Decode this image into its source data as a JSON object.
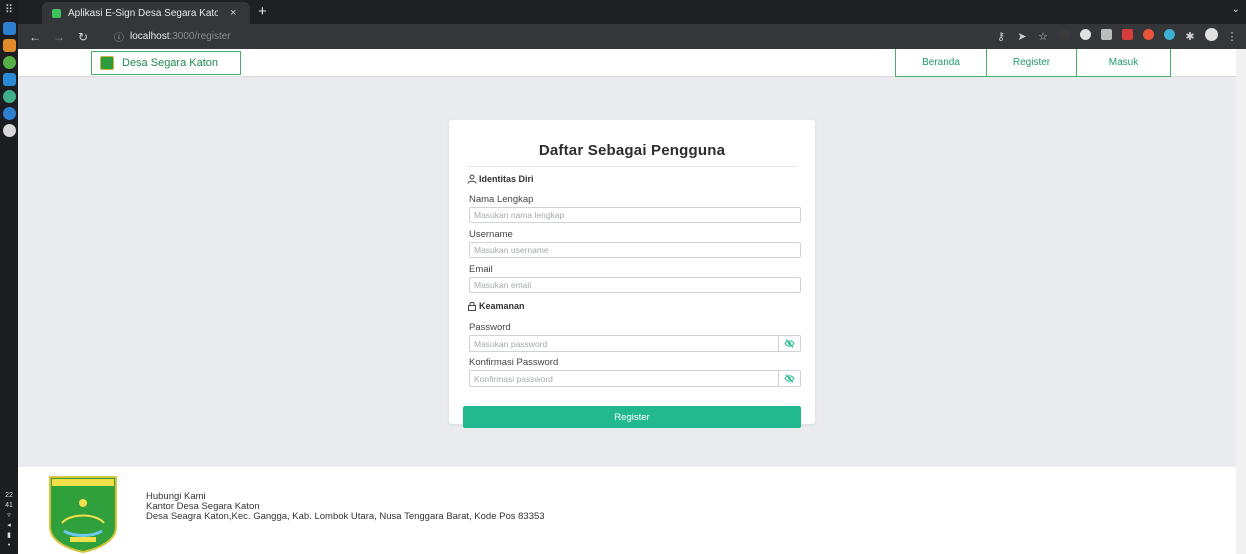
{
  "dock": {
    "grid_glyph": "⠿",
    "apps": [
      {
        "icon": "files-icon",
        "color": "#2f7fd1"
      },
      {
        "icon": "store-icon",
        "color": "#e08a2a"
      },
      {
        "icon": "chrome-icon",
        "color": "#56b046"
      },
      {
        "icon": "vscode-icon",
        "color": "#2a8ad6"
      },
      {
        "icon": "emoji-icon",
        "color": "#3fb08a"
      },
      {
        "icon": "check-icon",
        "color": "#2f7fd1"
      },
      {
        "icon": "drive-icon",
        "color": "#d8d8d8"
      }
    ],
    "clock_hour": "22",
    "clock_minute": "41"
  },
  "browser": {
    "tab_title": "Aplikasi E-Sign Desa Segara Katon",
    "tab_close": "×",
    "new_tab": "+",
    "address_host": "localhost",
    "address_path": ":3000/register"
  },
  "navbar": {
    "brand": "Desa Segara Katon",
    "links": {
      "beranda": "Beranda",
      "register": "Register",
      "masuk": "Masuk"
    }
  },
  "form": {
    "title": "Daftar Sebagai Pengguna",
    "section_identity": "Identitas Diri",
    "fullname_label": "Nama Lengkap",
    "fullname_placeholder": "Masukan nama lengkap",
    "username_label": "Username",
    "username_placeholder": "Masukan username",
    "email_label": "Email",
    "email_placeholder": "Masukan email",
    "section_security": "Keamanan",
    "password_label": "Password",
    "password_placeholder": "Masukan password",
    "confirm_label": "Konfirmasi Password",
    "confirm_placeholder": "Konfirmasi password",
    "submit_label": "Register"
  },
  "footer": {
    "contact_heading": "Hubungi Kami",
    "office": "Kantor Desa Segara Katon",
    "address": "Desa Seagra Katon,Kec. Gangga, Kab. Lombok Utara, Nusa Tenggara Barat, Kode Pos 83353"
  },
  "colors": {
    "accent": "#23b98e",
    "brand_green": "#1f8a52",
    "border_green": "#46b06a"
  }
}
